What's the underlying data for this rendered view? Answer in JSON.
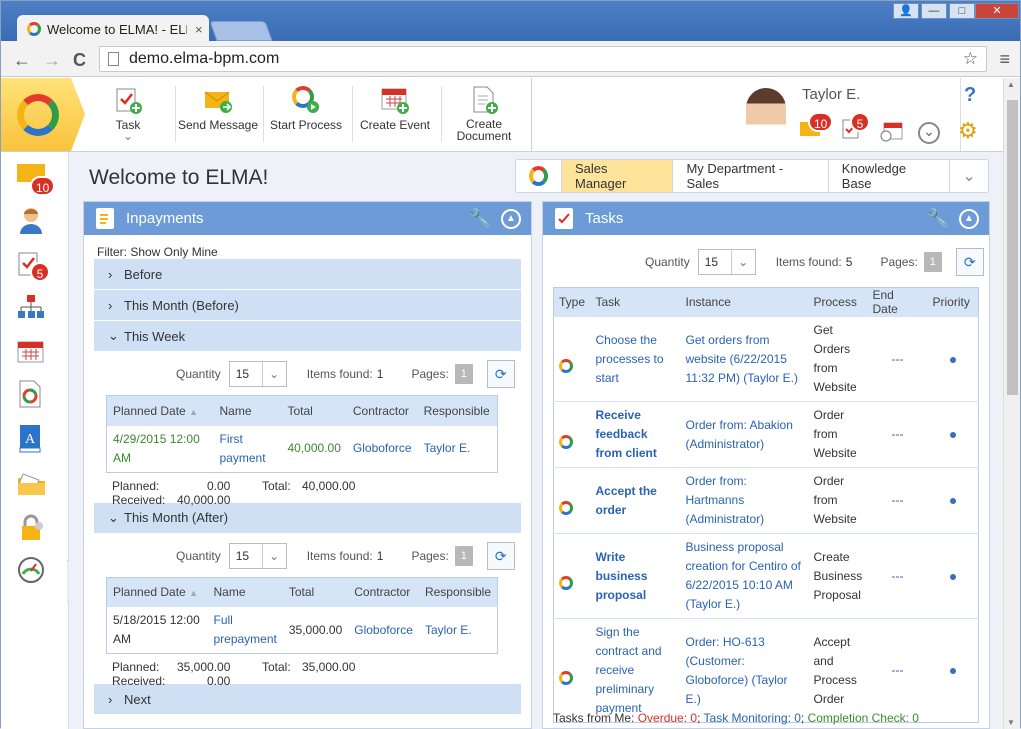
{
  "browser": {
    "tab_title": "Welcome to ELMA! - ELMA",
    "tab_close": "×",
    "url": "demo.elma-bpm.com",
    "back": "←",
    "forward": "→",
    "reload": "C",
    "menu": "≡",
    "star": "☆",
    "win_user": "👤",
    "win_min": "—",
    "win_max": "□",
    "win_close": "✕"
  },
  "toolbar": {
    "task_label": "Task",
    "task_arrow": "⌄",
    "send_message_label": "Send Message",
    "start_process_label": "Start Process",
    "create_event_label": "Create Event",
    "create_document_label": "Create Document"
  },
  "user": {
    "name": "Taylor E.",
    "messages_count": "10",
    "tasks_count": "5",
    "help": "?"
  },
  "sidebar": {
    "messages_count": "10",
    "tasks_count": "5",
    "collapse": "›"
  },
  "page": {
    "title": "Welcome to ELMA!",
    "roles": [
      "Sales Manager",
      "My Department - Sales",
      "Knowledge Base"
    ],
    "roles_more": "⌄"
  },
  "inpayments": {
    "title": "Inpayments",
    "filter": "Filter: Show Only Mine",
    "groups": {
      "before": "Before",
      "this_month_before": "This Month (Before)",
      "this_week": "This Week",
      "this_month_after": "This Month (After)",
      "next": "Next"
    },
    "chevron_right": "›",
    "chevron_down": "⌄",
    "quantity_label": "Quantity",
    "quantity_value": "15",
    "items_found_label": "Items found:",
    "pages_label": "Pages:",
    "columns": [
      "Planned Date",
      "Name",
      "Total",
      "Contractor",
      "Responsible"
    ],
    "sort_icon": "▲",
    "week": {
      "items_found": "1",
      "page": "1",
      "row": {
        "date": "4/29/2015 12:00 AM",
        "name": "First payment",
        "total": "40,000.00",
        "contractor": "Globoforce",
        "responsible": "Taylor E."
      },
      "planned_label": "Planned:",
      "planned_value": "0.00",
      "received_label": "Received:",
      "received_value": "40,000.00",
      "total_label": "Total:",
      "total_value": "40,000.00"
    },
    "after": {
      "items_found": "1",
      "page": "1",
      "row": {
        "date": "5/18/2015 12:00 AM",
        "name": "Full prepayment",
        "total": "35,000.00",
        "contractor": "Globoforce",
        "responsible": "Taylor E."
      },
      "planned_label": "Planned:",
      "planned_value": "35,000.00",
      "received_label": "Received:",
      "received_value": "0.00",
      "total_label": "Total:",
      "total_value": "35,000.00"
    }
  },
  "tasks": {
    "title": "Tasks",
    "quantity_label": "Quantity",
    "quantity_value": "15",
    "items_found_label": "Items found:",
    "items_found": "5",
    "pages_label": "Pages:",
    "page": "1",
    "columns": [
      "Type",
      "Task",
      "Instance",
      "Process",
      "End Date",
      "Priority"
    ],
    "rows": [
      {
        "task": "Choose the processes to start",
        "instance": "Get orders from website (6/22/2015 11:32 PM) (Taylor E.)",
        "process": "Get Orders from Website",
        "end_date": "---"
      },
      {
        "task": "Receive feedback from client",
        "instance": "Order from: Abakion (Administrator)",
        "process": "Order from Website",
        "end_date": "---"
      },
      {
        "task": "Accept the order",
        "instance": "Order from: Hartmanns (Administrator)",
        "process": "Order from Website",
        "end_date": "---"
      },
      {
        "task": "Write business proposal",
        "instance": "Business proposal creation for Centiro of 6/22/2015 10:10 AM (Taylor E.)",
        "process": "Create Business Proposal",
        "end_date": "---"
      },
      {
        "task": "Sign the contract and receive preliminary payment",
        "instance": "Order: HO-613 (Customer: Globoforce) (Taylor E.)",
        "process": "Accept and Process Order",
        "end_date": "---"
      }
    ],
    "footer": {
      "prefix": "Tasks from Me:",
      "overdue": "Overdue: 0",
      "monitoring": "Task Monitoring: 0",
      "completion": "Completion Check: 0"
    }
  },
  "colors": {
    "accent": "#6c9bd8",
    "role_active": "#fde49a",
    "badge": "#d93025",
    "overdue": "#d93025",
    "completion": "#3b8a2e"
  }
}
